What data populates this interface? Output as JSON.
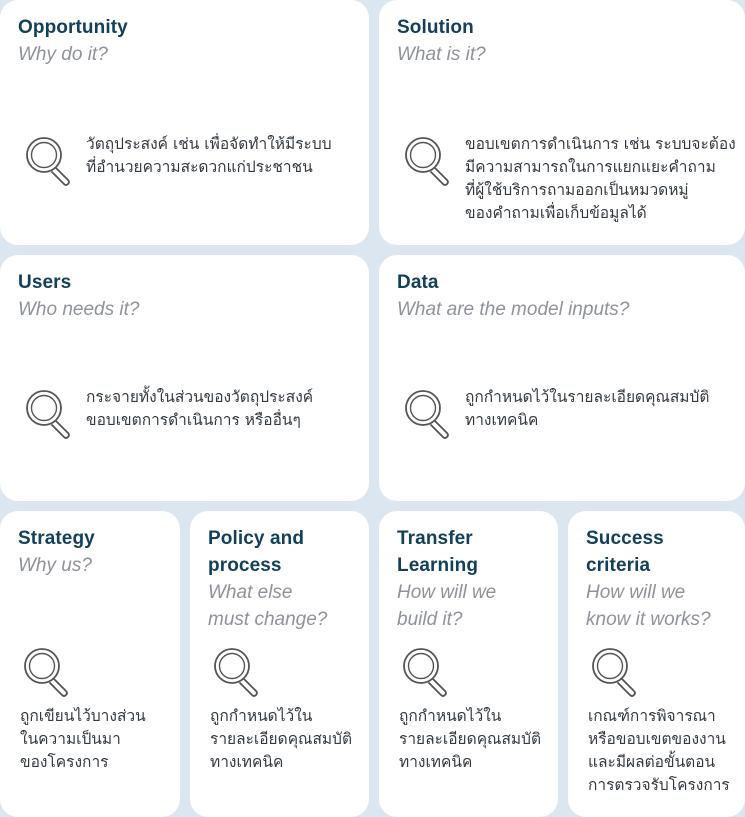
{
  "cards": {
    "opportunity": {
      "title": "Opportunity",
      "subtitle": "Why do it?",
      "text": [
        "วัตถุประสงค์ เช่น เพื่อจัดทำให้มีระบบ",
        "ที่อำนวยความสะดวกแก่ประชาชน"
      ]
    },
    "solution": {
      "title": "Solution",
      "subtitle": "What is it?",
      "text": [
        "ขอบเขตการดำเนินการ เช่น ระบบจะต้อง",
        "มีความสามารถในการแยกแยะคำถาม",
        "ที่ผู้ใช้บริการถามออกเป็นหมวดหมู่",
        "ของคำถามเพื่อเก็บข้อมูลได้"
      ]
    },
    "users": {
      "title": "Users",
      "subtitle": "Who needs it?",
      "text": [
        "กระจายทั้งในส่วนของวัตถุประสงค์",
        "ขอบเขตการดำเนินการ หรืออื่นๆ"
      ]
    },
    "data": {
      "title": "Data",
      "subtitle": "What are the model inputs?",
      "text": [
        "ถูกกำหนดไว้ในรายละเอียดคุณสมบัติ",
        "ทางเทคนิค"
      ]
    },
    "strategy": {
      "title": [
        "Strategy"
      ],
      "subtitle": [
        "Why us?"
      ],
      "text": [
        "ถูกเขียนไว้บางส่วน",
        "ในความเป็นมา",
        "ของโครงการ"
      ]
    },
    "policy": {
      "title": [
        "Policy and",
        "process"
      ],
      "subtitle": [
        "What else",
        "must change?"
      ],
      "text": [
        "ถูกกำหนดไว้ใน",
        "รายละเอียดคุณสมบัติ",
        "ทางเทคนิค"
      ]
    },
    "transfer": {
      "title": [
        "Transfer",
        "Learning"
      ],
      "subtitle": [
        "How will we",
        "build it?"
      ],
      "text": [
        "ถูกกำหนดไว้ใน",
        "รายละเอียดคุณสมบัติ",
        "ทางเทคนิค"
      ]
    },
    "success": {
      "title": [
        "Success",
        "criteria"
      ],
      "subtitle": [
        "How will we",
        "know it works?"
      ],
      "text": [
        "เกณฑ์การพิจารณา",
        "หรือขอบเขตของงาน",
        "และมีผลต่อขั้นตอน",
        "การตรวจรับโครงการ"
      ]
    }
  },
  "colors": {
    "title": "#13405a",
    "subtitle": "#8f9399",
    "body": "#333a40",
    "background": "#dbe6f1",
    "card": "#ffffff"
  },
  "icon": "magnifier-icon"
}
